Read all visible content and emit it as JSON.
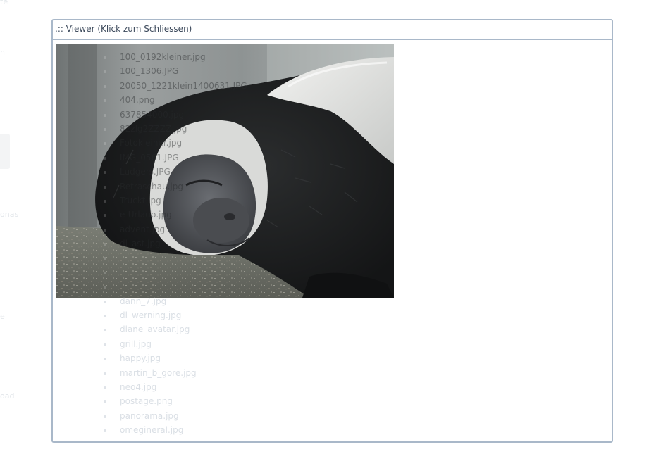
{
  "viewer": {
    "title": ".:: Viewer (Klick zum Schliessen)"
  },
  "background_left": {
    "fragments": [
      "te",
      "n",
      "onas",
      "e",
      "oad"
    ]
  },
  "files": [
    "100_0192kleiner.jpg",
    "100_1306.JPG",
    "20050_1221klein1400631.JPG",
    "404.png",
    "637854000.jpg",
    "82zlg2ZZZZ.jpg",
    "Fotokleiner.jpg",
    "IMG_0561.JPG",
    "Ludgers.JPG",
    "Retraschau.jpg",
    "Truckt.jpg",
    "e-Urlaub.jpg",
    "advent.jpg",
    "dl_ast.jpg",
    "",
    "",
    "",
    "dann_7.jpg",
    "dl_werning.jpg",
    "diane_avatar.jpg",
    "grill.jpg",
    "happy.jpg",
    "martin_b_gore.jpg",
    "neo4.jpg",
    "postage.png",
    "panorama.jpg",
    "omegineral.jpg"
  ],
  "photo": {
    "subject": "sleeping-colobus-monkey"
  }
}
